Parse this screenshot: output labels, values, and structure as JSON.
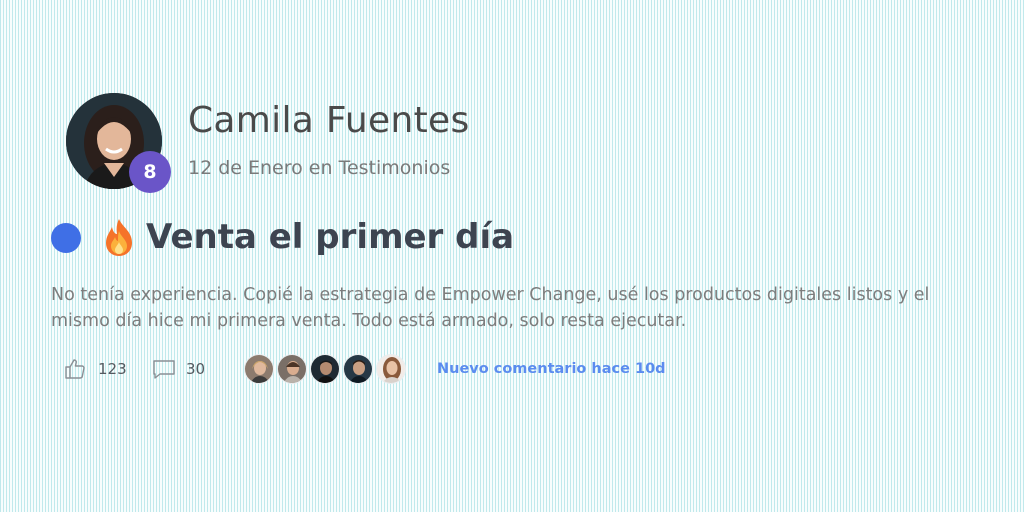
{
  "post": {
    "author": {
      "name": "Camila Fuentes",
      "level": "8"
    },
    "meta": "12 de Enero en Testimonios",
    "title": "Venta el primer día",
    "title_icon": "fire-emoji",
    "body": "No tenía experiencia. Copié la estrategia de Empower Change, usé los productos digitales listos y el mismo día hice mi primera venta. Todo está armado, solo resta ejecutar.",
    "likes": "123",
    "comments": "30",
    "latest_comment": "Nuevo comentario hace 10d"
  },
  "colors": {
    "unread_dot": "#3f6fe6",
    "level_badge": "#6a55c8",
    "link": "#5b8cef",
    "title": "#3d4450"
  }
}
